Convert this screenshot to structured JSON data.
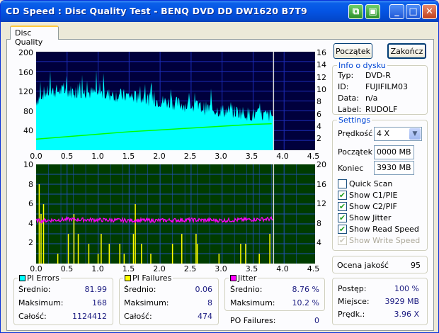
{
  "window": {
    "title": "CD Speed : Disc Quality Test - BENQ    DVD DD DW1620    B7T9"
  },
  "tabs": {
    "active": "Disc Quality"
  },
  "colors": {
    "read_speed": "#00ff00",
    "pie": "#00ffff",
    "pif": "#ffff00",
    "jitter": "#ff00ff",
    "graph1_bg": "#00003c",
    "graph2_bg": "#003c00",
    "accent": "#0046d5"
  },
  "axes": {
    "top_left": [
      "200",
      "160",
      "120",
      "80",
      "40"
    ],
    "top_right": [
      "16",
      "14",
      "12",
      "10",
      "8",
      "6",
      "4",
      "2"
    ],
    "bottom_left": [
      "10",
      "8",
      "6",
      "4",
      "2"
    ],
    "bottom_right": [
      "20",
      "16",
      "12",
      "8",
      "4"
    ],
    "x": [
      "0.0",
      "0.5",
      "1.0",
      "1.5",
      "2.0",
      "2.5",
      "3.0",
      "3.5",
      "4.0",
      "4.5"
    ]
  },
  "chart_data": [
    {
      "type": "area",
      "ylim": [
        0,
        200
      ],
      "y2lim": [
        0,
        16
      ],
      "xlim": [
        0,
        4.5
      ],
      "series": [
        {
          "values_desc": "PI Errors per block",
          "x": [
            0.0,
            0.1,
            0.25,
            0.5,
            0.75,
            1.0,
            1.25,
            1.5,
            1.75,
            2.0,
            2.25,
            2.5,
            2.75,
            3.0,
            3.25,
            3.5,
            3.75,
            3.8
          ],
          "y": [
            100,
            115,
            120,
            120,
            118,
            115,
            112,
            110,
            105,
            100,
            95,
            90,
            85,
            80,
            78,
            72,
            70,
            70
          ]
        },
        {
          "values_desc": "read speed",
          "x": [
            0.0,
            0.5,
            1.0,
            1.5,
            2.0,
            2.5,
            3.0,
            3.5,
            3.8
          ],
          "y": [
            1.8,
            2.2,
            2.6,
            3.0,
            3.3,
            3.6,
            3.9,
            4.2,
            4.3
          ]
        }
      ],
      "marker_x": 3.83
    },
    {
      "type": "bar",
      "ylim": [
        0,
        10
      ],
      "y2lim": [
        0,
        20
      ],
      "xlim": [
        0,
        4.5
      ],
      "series": [
        {
          "values_desc": "PI Failures",
          "x": [
            0.05,
            0.08,
            0.12,
            0.35,
            0.52,
            0.61,
            0.68,
            0.85,
            1.0,
            1.05,
            1.18,
            1.35,
            1.42,
            1.57,
            1.6,
            1.7,
            1.85,
            2.2,
            2.35,
            2.58,
            2.6,
            2.95,
            3.3,
            3.38,
            3.6,
            3.77
          ],
          "y": [
            8,
            5,
            6,
            1,
            3,
            5,
            3,
            2,
            1,
            3,
            2,
            2,
            1,
            3,
            6,
            2,
            1,
            2,
            3,
            3,
            2,
            1,
            2,
            2,
            1,
            3
          ]
        },
        {
          "values_desc": "Jitter",
          "x": [
            0.0,
            0.5,
            1.0,
            1.5,
            2.0,
            2.5,
            3.0,
            3.5,
            3.8
          ],
          "y": [
            8.6,
            8.9,
            8.8,
            8.7,
            8.7,
            8.8,
            8.7,
            8.9,
            9.0
          ]
        }
      ],
      "marker_x": 3.83
    }
  ],
  "buttons": {
    "start": "Początek",
    "end": "Zakończ"
  },
  "disc_info": {
    "title": "Info o dysku",
    "rows": [
      {
        "label": "Typ:",
        "value": "DVD-R"
      },
      {
        "label": "ID:",
        "value": "FUJIFILM03"
      },
      {
        "label": "Data:",
        "value": "n/a"
      },
      {
        "label": "Label:",
        "value": "RUDOLF"
      }
    ]
  },
  "settings": {
    "title": "Settings",
    "speed_label": "Prędkość",
    "speed_value": "4 X",
    "start_label": "Początek",
    "start_value": "0000 MB",
    "end_label": "Koniec",
    "end_value": "3930 MB",
    "checks": [
      {
        "label": "Quick Scan",
        "checked": false,
        "disabled": false
      },
      {
        "label": "Show C1/PIE",
        "checked": true,
        "disabled": false
      },
      {
        "label": "Show C2/PIF",
        "checked": true,
        "disabled": false
      },
      {
        "label": "Show Jitter",
        "checked": true,
        "disabled": false
      },
      {
        "label": "Show Read Speed",
        "checked": true,
        "disabled": false
      },
      {
        "label": "Show Write Speed",
        "checked": true,
        "disabled": true
      }
    ]
  },
  "quality": {
    "label": "Ocena jakość",
    "value": "95"
  },
  "progress": {
    "rows": [
      {
        "label": "Postęp:",
        "value": "100 %"
      },
      {
        "label": "Miejsce:",
        "value": "3929 MB"
      },
      {
        "label": "Prędk.:",
        "value": "3.96 X"
      }
    ]
  },
  "pi_errors": {
    "title": "PI Errors",
    "rows": [
      {
        "label": "Średnio:",
        "value": "81.99"
      },
      {
        "label": "Maksimum:",
        "value": "168"
      },
      {
        "label": "Całość:",
        "value": "1124412"
      }
    ]
  },
  "pi_failures": {
    "title": "PI Failures",
    "rows": [
      {
        "label": "Średnio:",
        "value": "0.06"
      },
      {
        "label": "Maksimum:",
        "value": "8"
      },
      {
        "label": "Całość:",
        "value": "474"
      }
    ]
  },
  "jitter": {
    "title": "Jitter",
    "rows": [
      {
        "label": "Średnio:",
        "value": "8.76 %"
      },
      {
        "label": "Maksimum:",
        "value": "10.2 %"
      }
    ],
    "po_label": "PO Failures:",
    "po_value": "0"
  }
}
